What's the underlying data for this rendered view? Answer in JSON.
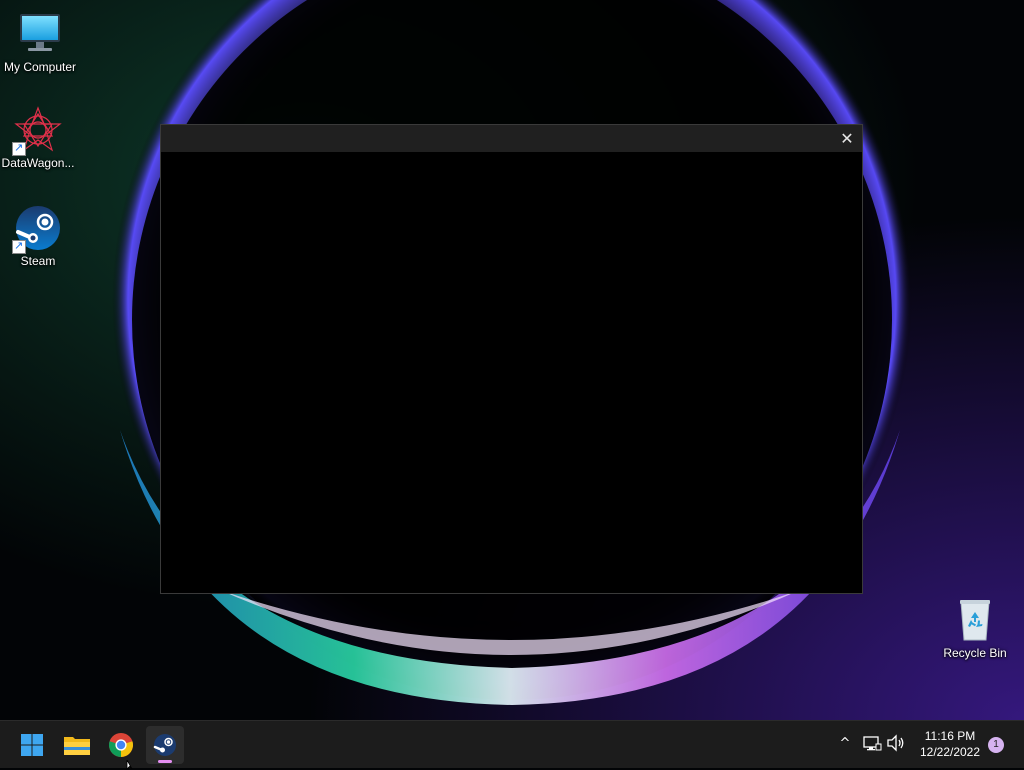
{
  "desktop": {
    "icons": [
      {
        "label": "My Computer",
        "icon": "monitor-icon"
      },
      {
        "label": "DataWagon...",
        "icon": "datawagon-icon"
      },
      {
        "label": "Steam",
        "icon": "steam-icon"
      },
      {
        "label": "Recycle Bin",
        "icon": "recycle-bin-icon"
      }
    ]
  },
  "window": {
    "title": "",
    "close_glyph": "✕"
  },
  "taskbar": {
    "apps": [
      {
        "name": "Start",
        "icon": "windows-logo-icon"
      },
      {
        "name": "File Explorer",
        "icon": "folder-icon"
      },
      {
        "name": "Google Chrome",
        "icon": "chrome-icon"
      },
      {
        "name": "Steam",
        "icon": "steam-icon",
        "active": true
      }
    ],
    "tray": {
      "chevron_glyph": "^",
      "time": "11:16 PM",
      "date": "12/22/2022",
      "notifications": "1"
    }
  },
  "colors": {
    "taskbar": "#1c1c1c",
    "window_titlebar": "#202020",
    "accent_indicator": "#e58ff2"
  }
}
